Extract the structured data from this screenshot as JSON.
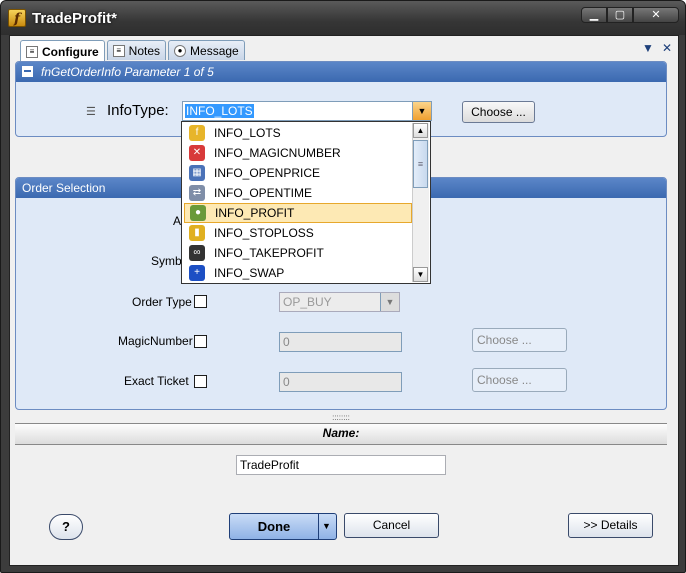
{
  "window": {
    "title": "TradeProfit*",
    "app_icon_glyph": "f",
    "min_glyph": "▁",
    "max_glyph": "▢",
    "close_glyph": "✕"
  },
  "tabs": [
    {
      "label": "Configure",
      "icon": "configure-icon"
    },
    {
      "label": "Notes",
      "icon": "notes-icon"
    },
    {
      "label": "Message",
      "icon": "message-icon"
    }
  ],
  "tab_controls": {
    "menu_glyph": "▼",
    "close_glyph": "✕"
  },
  "param_panel": {
    "title": "fnGetOrderInfo Parameter 1 of 5",
    "infotype_label": "InfoType:",
    "infotype_value": "INFO_LOTS",
    "choose_label": "Choose ..."
  },
  "dropdown": {
    "items": [
      {
        "label": "INFO_LOTS",
        "icon": "function-icon",
        "color": "#e7b52a",
        "glyph": "f"
      },
      {
        "label": "INFO_MAGICNUMBER",
        "icon": "error-x-icon",
        "color": "#d83a3a",
        "glyph": "✕"
      },
      {
        "label": "INFO_OPENPRICE",
        "icon": "hierarchy-icon",
        "color": "#4a72b8",
        "glyph": "▦"
      },
      {
        "label": "INFO_OPENTIME",
        "icon": "document-arrows-icon",
        "color": "#7f8ea8",
        "glyph": "⇄"
      },
      {
        "label": "INFO_PROFIT",
        "icon": "user-icon",
        "color": "#6a9a3a",
        "glyph": "●"
      },
      {
        "label": "INFO_STOPLOSS",
        "icon": "cylinder-icon",
        "color": "#e0b020",
        "glyph": "▮"
      },
      {
        "label": "INFO_TAKEPROFIT",
        "icon": "binoculars-icon",
        "color": "#333333",
        "glyph": "∞"
      },
      {
        "label": "INFO_SWAP",
        "icon": "plus-circle-icon",
        "color": "#1c4fc4",
        "glyph": "+"
      }
    ],
    "highlighted_index": 4
  },
  "order_panel": {
    "title": "Order Selection",
    "partial_label_1": "A",
    "partial_label_2": "Symbo",
    "order_type_label": "Order Type",
    "order_type_value": "OP_BUY",
    "magic_label": "MagicNumber",
    "magic_value": "0",
    "ticket_label": "Exact Ticket",
    "ticket_value": "0",
    "choose_label": "Choose ..."
  },
  "name_section": {
    "header": "Name:",
    "value": "TradeProfit"
  },
  "footer": {
    "help_label": "?",
    "done_label": "Done",
    "cancel_label": "Cancel",
    "details_label": ">> Details"
  },
  "colors": {
    "accent": "#3b69b0",
    "panel_bg": "#dfe9f7",
    "highlight": "#fde9b4"
  }
}
